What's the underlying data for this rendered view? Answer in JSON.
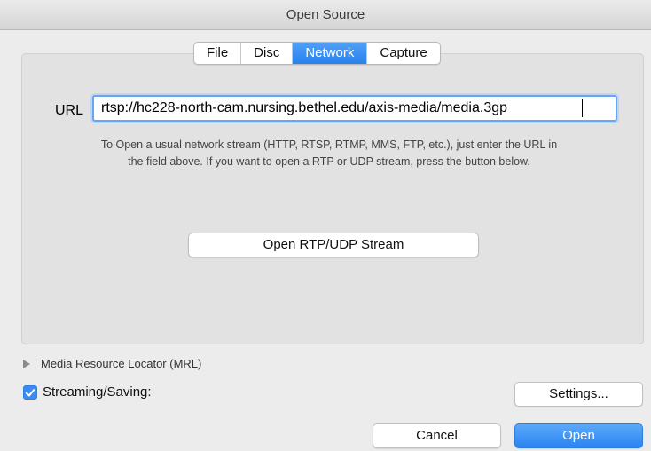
{
  "window": {
    "title": "Open Source"
  },
  "tabs": [
    {
      "label": "File"
    },
    {
      "label": "Disc"
    },
    {
      "label": "Network"
    },
    {
      "label": "Capture"
    }
  ],
  "network": {
    "url_label": "URL",
    "url_value": "rtsp://hc228-north-cam.nursing.bethel.edu/axis-media/media.3gp",
    "help_line1": "To Open a usual network stream (HTTP, RTSP, RTMP, MMS, FTP, etc.), just enter the URL in",
    "help_line2": "the field above. If you want to open a RTP or UDP stream, press the button below.",
    "rtp_button": "Open RTP/UDP Stream"
  },
  "mrl": {
    "label": "Media Resource Locator (MRL)"
  },
  "streaming": {
    "label": "Streaming/Saving:",
    "checked": true,
    "settings_button": "Settings..."
  },
  "footer": {
    "cancel": "Cancel",
    "open": "Open"
  },
  "colors": {
    "accent": "#2b84f0",
    "focus_ring": "#6aa5f0"
  }
}
